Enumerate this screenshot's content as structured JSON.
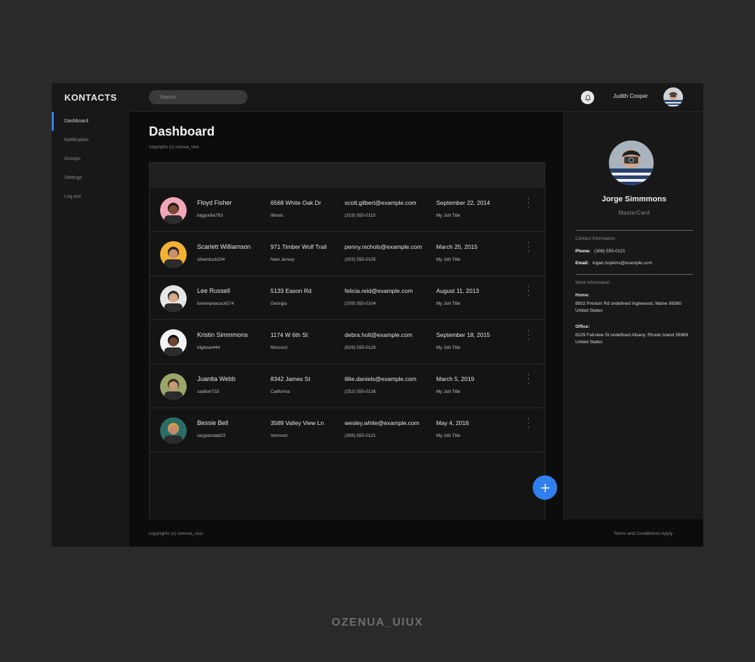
{
  "app": {
    "brand": "KONTACTS"
  },
  "sidebar": {
    "items": [
      {
        "label": "Dashboard",
        "active": true
      },
      {
        "label": "Notification",
        "active": false
      },
      {
        "label": "Groups",
        "active": false
      },
      {
        "label": "Settings",
        "active": false
      },
      {
        "label": "Log out",
        "active": false
      }
    ]
  },
  "topbar": {
    "search_placeholder": "Search",
    "user_name": "Judith Cooper",
    "bell_icon": "bell-icon"
  },
  "main": {
    "title": "Dashboard",
    "subtitle": "copyrights (c) ozenua_uiux"
  },
  "contacts": [
    {
      "name": "Floyd Fisher",
      "username": "biggorilla763",
      "street": "6568 White Oak Dr",
      "state": "Illinois",
      "email": "scott.gilbert@example.com",
      "phone": "(319) 555-0115",
      "date": "September 22, 2014",
      "job": "My Job Title",
      "avatar_bg": "#f3a6b8",
      "skin": "#7a4a30",
      "hair": "#1c1c1c"
    },
    {
      "name": "Scarlett Williamson",
      "username": "silverduck204",
      "street": "971 Timber Wolf Trail",
      "state": "New Jersey",
      "email": "penny.nichols@example.com",
      "phone": "(303) 555-0105",
      "date": "March 25, 2015",
      "job": "My Job Title",
      "avatar_bg": "#f2b233",
      "skin": "#c69070",
      "hair": "#2a1a12"
    },
    {
      "name": "Lee Russell",
      "username": "brownpeacock574",
      "street": "5133 Eason Rd",
      "state": "Georgia",
      "email": "felicia.reid@example.com",
      "phone": "(209) 555-0104",
      "date": "August 11, 2013",
      "job": "My Job Title",
      "avatar_bg": "#e6e6e6",
      "skin": "#d8aa88",
      "hair": "#2b2b2b"
    },
    {
      "name": "Kristin Simmmons",
      "username": "bigbear444",
      "street": "1174 W 6th St",
      "state": "Missouri",
      "email": "debra.holt@example.com",
      "phone": "(629) 555-0129",
      "date": "September 18, 2015",
      "job": "My Job Title",
      "avatar_bg": "#f4f4f4",
      "skin": "#6b4530",
      "hair": "#111111"
    },
    {
      "name": "Juanita Webb",
      "username": "sadlion733",
      "street": "8342 James St",
      "state": "California",
      "email": "lillie.daniels@example.com",
      "phone": "(252) 555-0126",
      "date": "March 5, 2019",
      "job": "My Job Title",
      "avatar_bg": "#9aa56a",
      "skin": "#c49a78",
      "hair": "#3a2a1a"
    },
    {
      "name": "Bessie Bell",
      "username": "lazypanda823",
      "street": "3589 Valley View Ln",
      "state": "Vermont",
      "email": "wesley.white@example.com",
      "phone": "(308) 555-0121",
      "date": "May 4, 2016",
      "job": "My Job Title",
      "avatar_bg": "#2c6d6a",
      "skin": "#c48a6a",
      "hair": "#d9a040"
    }
  ],
  "profile": {
    "name": "Jorge Simmmons",
    "card": "MasterCard",
    "contact_label": "Contact Information",
    "phone_label": "Phone:",
    "phone": "(308) 555-0121",
    "email_label": "Email:",
    "email": "logan.hopkins@example.com",
    "work_label": "Work Information",
    "home_label": "Home:",
    "home": "8502 Preston Rd undefined Inglewood, Maine 98380 United States",
    "office_label": "Office:",
    "office": "6229 Fairview St undefined Albany, Rhode Island 56989 United States"
  },
  "footer": {
    "left": "copyrights (c) ozenua_uiux",
    "right": "Terms and Conditionsn Apply"
  },
  "watermark": "OZENUA_UIUX",
  "colors": {
    "accent": "#2f80ed",
    "background": "#2a2a2a",
    "app_bg": "#151515",
    "main_bg": "#0c0c0c"
  }
}
